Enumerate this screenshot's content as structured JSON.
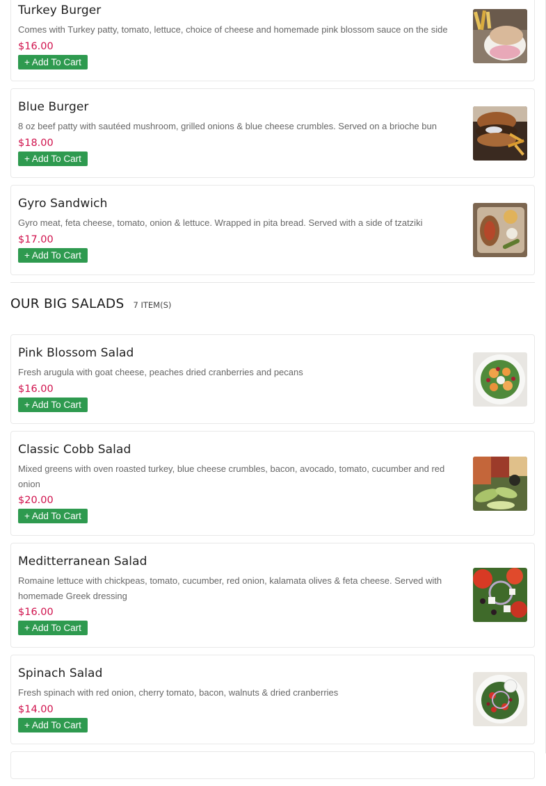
{
  "burgers": {
    "items": [
      {
        "name": "Turkey Burger",
        "description": "Comes with Turkey patty, tomato, lettuce, choice of cheese and homemade pink blossom sauce on the side",
        "price": "$16.00",
        "button": "+ Add To Cart",
        "image": "turkey-burger-photo"
      },
      {
        "name": "Blue Burger",
        "description": "8 oz beef patty with sautéed mushroom, grilled onions & blue cheese crumbles. Served on a brioche bun",
        "price": "$18.00",
        "button": "+ Add To Cart",
        "image": "blue-burger-photo"
      },
      {
        "name": "Gyro Sandwich",
        "description": "Gyro meat, feta cheese, tomato, onion & lettuce. Wrapped in pita bread. Served with a side of tzatziki",
        "price": "$17.00",
        "button": "+ Add To Cart",
        "image": "gyro-sandwich-photo"
      }
    ]
  },
  "salads": {
    "title": "OUR BIG SALADS",
    "count": "7 ITEM(S)",
    "items": [
      {
        "name": "Pink Blossom Salad",
        "description": "Fresh arugula with goat cheese, peaches dried cranberries and pecans",
        "price": "$16.00",
        "button": "+ Add To Cart",
        "image": "pink-blossom-salad-photo"
      },
      {
        "name": "Classic Cobb Salad",
        "description": "Mixed greens with oven roasted turkey, blue cheese crumbles, bacon, avocado, tomato, cucumber and red onion",
        "price": "$20.00",
        "button": "+ Add To Cart",
        "image": "classic-cobb-salad-photo"
      },
      {
        "name": "Meditterranean Salad",
        "description": "Romaine lettuce with chickpeas, tomato, cucumber, red onion, kalamata olives & feta cheese. Served with homemade Greek dressing",
        "price": "$16.00",
        "button": "+ Add To Cart",
        "image": "mediterranean-salad-photo"
      },
      {
        "name": "Spinach Salad",
        "description": "Fresh spinach with red onion, cherry tomato, bacon, walnuts & dried cranberries",
        "price": "$14.00",
        "button": "+ Add To Cart",
        "image": "spinach-salad-photo"
      }
    ]
  },
  "colors": {
    "price": "#d0114c",
    "button": "#2e9a4f",
    "border": "#e8e8e8"
  }
}
